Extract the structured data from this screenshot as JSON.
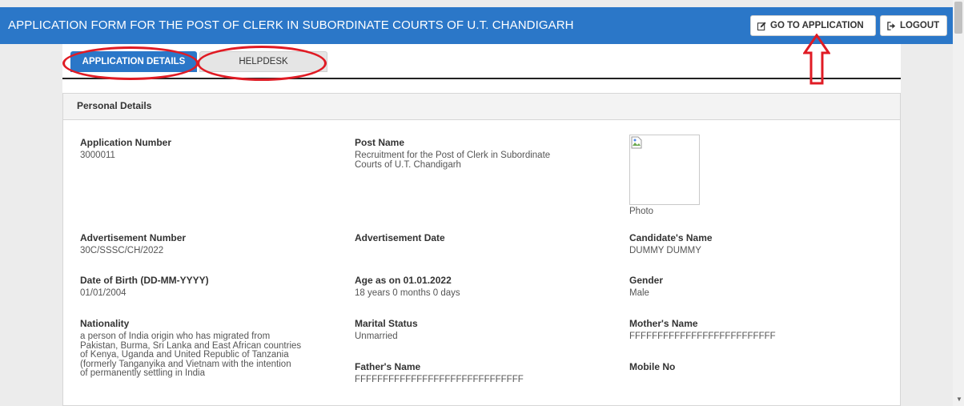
{
  "header": {
    "title": "APPLICATION FORM FOR THE POST OF CLERK IN SUBORDINATE COURTS OF U.T. CHANDIGARH",
    "go_label": "GO TO APPLICATION",
    "logout_label": "LOGOUT",
    "go_icon": "edit-icon",
    "logout_icon": "sign-out-icon"
  },
  "tabs": [
    {
      "label": "APPLICATION DETAILS",
      "active": true
    },
    {
      "label": "HELPDESK",
      "active": false
    }
  ],
  "panel": {
    "title": "Personal Details",
    "photo_label": "Photo",
    "fields": {
      "application_number": {
        "label": "Application Number",
        "value": "3000011"
      },
      "post_name": {
        "label": "Post Name",
        "value": [
          "Recruitment for the Post of Clerk in Subordinate",
          "Courts of U.T. Chandigarh"
        ]
      },
      "advertisement_number": {
        "label": "Advertisement Number",
        "value": "30C/SSSC/CH/2022"
      },
      "advertisement_date": {
        "label": "Advertisement Date",
        "value": ""
      },
      "candidate_name": {
        "label": "Candidate's Name",
        "value": "DUMMY DUMMY"
      },
      "dob": {
        "label": "Date of Birth (DD-MM-YYYY)",
        "value": "01/01/2004"
      },
      "age": {
        "label": "Age as on 01.01.2022",
        "value": "18 years 0 months 0 days"
      },
      "gender": {
        "label": "Gender",
        "value": "Male"
      },
      "nationality": {
        "label": "Nationality",
        "value": [
          "a person of India origin who has migrated from",
          "Pakistan, Burma, Sri Lanka and East African countries",
          "of Kenya, Uganda and United Republic of Tanzania",
          "(formerly Tanganyika and Vietnam with the intention",
          "of permanently settling in India"
        ]
      },
      "marital_status": {
        "label": "Marital Status",
        "value": "Unmarried"
      },
      "mother_name": {
        "label": "Mother's Name",
        "value": "FFFFFFFFFFFFFFFFFFFFFFFFFF"
      },
      "father_name": {
        "label": "Father's Name",
        "value": "FFFFFFFFFFFFFFFFFFFFFFFFFFFFFF"
      },
      "mobile_no": {
        "label": "Mobile No",
        "value": ""
      }
    }
  },
  "colors": {
    "header_bg": "#2b77c8",
    "annotation": "#e01b24"
  }
}
